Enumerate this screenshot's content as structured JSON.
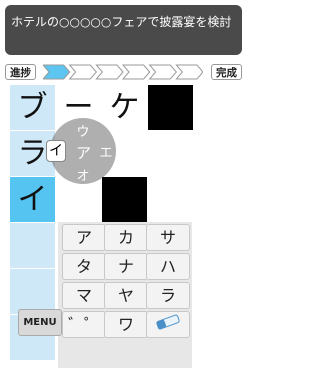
{
  "clue": {
    "text": "ホテルの○○○○○フェアで披露宴を検討"
  },
  "progress": {
    "start_label": "進捗",
    "end_label": "完成",
    "value_fraction": 0.2,
    "segments": 6
  },
  "grid": {
    "rows": [
      [
        {
          "ch": "ブ",
          "style": "light"
        },
        {
          "ch": "ー",
          "style": "white"
        },
        {
          "ch": "ケ",
          "style": "white"
        },
        {
          "ch": "",
          "style": "black"
        },
        {
          "ch": "",
          "style": "white"
        }
      ],
      [
        {
          "ch": "ラ",
          "style": "light"
        },
        {
          "ch": "",
          "style": "white"
        },
        {
          "ch": "",
          "style": "white"
        },
        {
          "ch": "",
          "style": "white"
        },
        {
          "ch": "",
          "style": "white"
        }
      ],
      [
        {
          "ch": "イ",
          "style": "active"
        },
        {
          "ch": "",
          "style": "white"
        },
        {
          "ch": "",
          "style": "black"
        },
        {
          "ch": "",
          "style": "white"
        },
        {
          "ch": "",
          "style": "white"
        }
      ],
      [
        {
          "ch": "",
          "style": "light"
        },
        {
          "ch": "",
          "style": "white"
        },
        {
          "ch": "",
          "style": "white"
        },
        {
          "ch": "",
          "style": "white"
        },
        {
          "ch": "",
          "style": "white"
        }
      ],
      [
        {
          "ch": "",
          "style": "light"
        },
        {
          "ch": "",
          "style": "white"
        },
        {
          "ch": "",
          "style": "white"
        },
        {
          "ch": "",
          "style": "white"
        },
        {
          "ch": "",
          "style": "white"
        }
      ],
      [
        {
          "ch": "",
          "style": "light"
        },
        {
          "ch": "",
          "style": "white"
        },
        {
          "ch": "",
          "style": "white"
        },
        {
          "ch": "",
          "style": "white"
        },
        {
          "ch": "",
          "style": "white"
        }
      ]
    ]
  },
  "flick_popup": {
    "center": "ア",
    "up": "ウ",
    "right": "エ",
    "down": "オ",
    "left": "イ"
  },
  "keyboard": {
    "rows": [
      [
        "ア",
        "カ",
        "サ"
      ],
      [
        "タ",
        "ナ",
        "ハ"
      ],
      [
        "マ",
        "ヤ",
        "ラ"
      ],
      [
        "゛゜",
        "ワ",
        ""
      ]
    ],
    "menu_label": "MENU",
    "eraser_icon": "eraser-icon"
  }
}
